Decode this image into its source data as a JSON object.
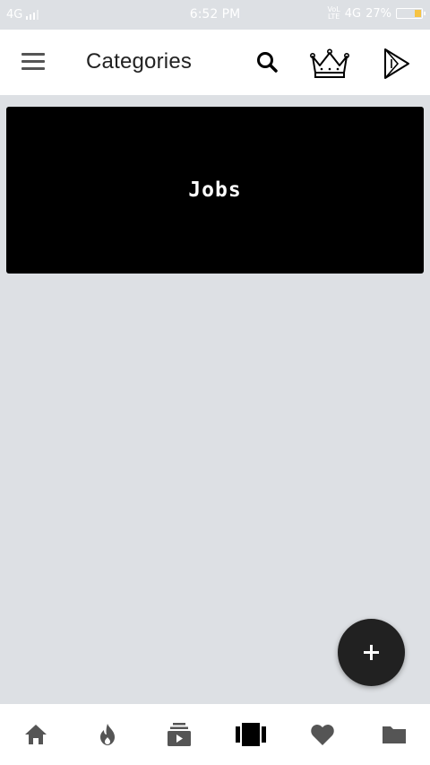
{
  "status_bar": {
    "network": "4G",
    "time": "6:52 PM",
    "network_right": "4G",
    "battery": "27%",
    "battery_level": 0.27
  },
  "app_bar": {
    "title": "Categories",
    "icons": [
      "menu-icon",
      "search-icon",
      "crown-icon",
      "play-store-icon"
    ]
  },
  "categories": [
    {
      "label": "Jobs"
    }
  ],
  "fab": {
    "icon": "plus-icon"
  },
  "bottom_nav": {
    "items": [
      "home-icon",
      "fire-icon",
      "subscriptions-icon",
      "categories-icon",
      "favorites-icon",
      "folder-icon"
    ],
    "active_index": 3
  },
  "colors": {
    "background": "#dde0e4",
    "app_bar": "#ffffff",
    "card": "#000000",
    "fab": "#212121",
    "icon_inactive": "#555555",
    "icon_active": "#000000"
  }
}
